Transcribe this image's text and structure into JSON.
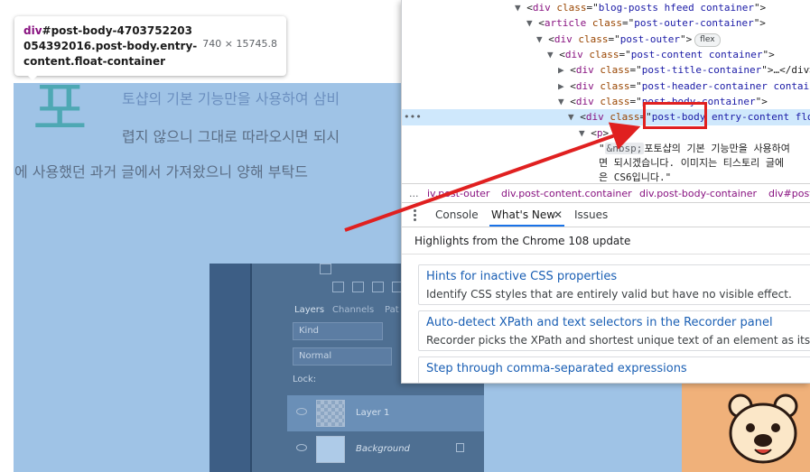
{
  "tooltip": {
    "selector_tag": "div",
    "selector_rest": "#post-body-4703752203054392016.post-body.entry-content.float-container",
    "size": "740 × 15745.8"
  },
  "blog": {
    "big_char": "포",
    "line1": "토샵의 기본 기능만을 사용하여 삼비",
    "line2": "렵지 않으니 그대로 따라오시면 되시",
    "line3": "에 사용했던 과거 글에서 가져왔으니 양해 부탁드"
  },
  "photoshop": {
    "tabs": [
      "Layers",
      "Channels",
      "Pat"
    ],
    "kind": "Kind",
    "blend_mode": "Normal",
    "lock_label": "Lock:",
    "layers": [
      {
        "name": "Layer 1"
      },
      {
        "name": "Background"
      }
    ]
  },
  "devtools": {
    "dom": {
      "l1_tag": "div",
      "l1_attr": "class",
      "l1_val": "blog-posts hfeed container",
      "l2_tag": "article",
      "l2_attr": "class",
      "l2_val": "post-outer-container",
      "l3_tag": "div",
      "l3_attr": "class",
      "l3_val": "post-outer",
      "l3_badge": "flex",
      "l4_tag": "div",
      "l4_attr": "class",
      "l4_val": "post-content container",
      "l5_tag": "div",
      "l5_attr": "class",
      "l5_val": "post-title-container",
      "l5_rest": "…</div>",
      "l6_tag": "div",
      "l6_attr": "class",
      "l6_val": "post-header-container contain",
      "l7_tag": "div",
      "l7_attr": "class",
      "l7_val": "post-body-container",
      "l8_dots": "•••",
      "l8_tag": "div",
      "l8_attr": "class",
      "l8_val": "post-body entry-content flo",
      "l9_tag": "p",
      "l10_badge": "&nbsp;",
      "l10_text": "포토샵의 기본 기능만을 사용하여",
      "l11_text": "면 되시겠습니다. 이미지는 티스토리 글에",
      "l12_text": "은 CS6입니다.\""
    },
    "breadcrumbs": {
      "dots": "...",
      "items": [
        "iv.post-outer",
        "div.post-content.container",
        "div.post-body-container",
        "div#post"
      ]
    },
    "drawer_tabs": {
      "console": "Console",
      "whats_new": "What's New",
      "close": "✕",
      "issues": "Issues"
    },
    "whats_new": {
      "title": "Highlights from the Chrome 108 update",
      "cards": [
        {
          "title": "Hints for inactive CSS properties",
          "desc": "Identify CSS styles that are entirely valid but have no visible effect."
        },
        {
          "title": "Auto-detect XPath and text selectors in the Recorder panel",
          "desc": "Recorder picks the XPath and shortest unique text of an element as its sele"
        },
        {
          "title": "Step through comma-separated expressions",
          "desc": ""
        }
      ]
    }
  },
  "colors": {
    "highlight": "#9fc3e6",
    "annotation_red": "#e02020",
    "link_blue": "#1a5fb4",
    "tab_underline": "#1a73e8"
  }
}
